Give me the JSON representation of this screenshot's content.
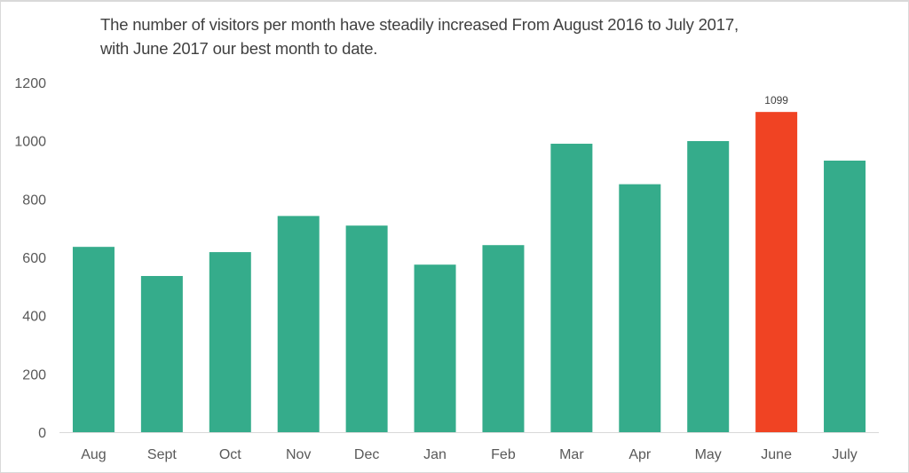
{
  "chart_data": {
    "type": "bar",
    "title": "The number of visitors per month have steadily increased From August 2016 to July 2017, with June 2017 our best month to date.",
    "title_lines": [
      "The number of visitors per month have steadily increased From August 2016 to July 2017,",
      "with June 2017 our best month to date."
    ],
    "xlabel": "",
    "ylabel": "",
    "categories": [
      "Aug",
      "Sept",
      "Oct",
      "Nov",
      "Dec",
      "Jan",
      "Feb",
      "Mar",
      "Apr",
      "May",
      "June",
      "July"
    ],
    "values": [
      636,
      536,
      618,
      742,
      709,
      575,
      642,
      990,
      851,
      999,
      1099,
      932
    ],
    "highlight_index": 10,
    "data_labels": [
      {
        "index": 10,
        "text": "1099"
      }
    ],
    "ylim": [
      0,
      1200
    ],
    "yticks": [
      0,
      200,
      400,
      600,
      800,
      1000,
      1200
    ],
    "grid": false,
    "legend": "none",
    "colors": {
      "bar": "#35AC8B",
      "highlight": "#F04323",
      "axis": "#d9d9d9",
      "text": "#595959"
    }
  }
}
